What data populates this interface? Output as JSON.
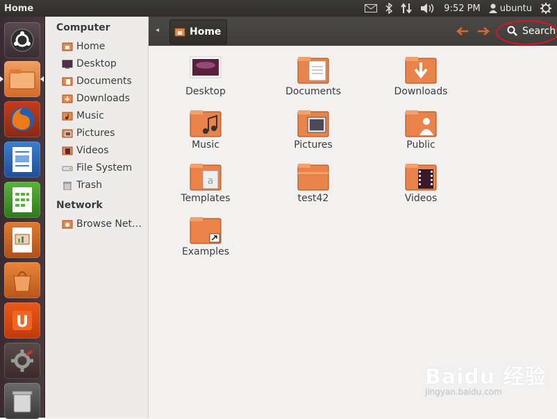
{
  "window": {
    "title": "Home"
  },
  "topbar": {
    "time": "9:52 PM",
    "user": "ubuntu"
  },
  "sidebar": {
    "sections": [
      {
        "heading": "Computer",
        "items": [
          {
            "label": "Home",
            "icon": "home-folder-icon"
          },
          {
            "label": "Desktop",
            "icon": "desktop-icon"
          },
          {
            "label": "Documents",
            "icon": "documents-folder-icon"
          },
          {
            "label": "Downloads",
            "icon": "downloads-folder-icon"
          },
          {
            "label": "Music",
            "icon": "music-folder-icon"
          },
          {
            "label": "Pictures",
            "icon": "pictures-folder-icon"
          },
          {
            "label": "Videos",
            "icon": "videos-folder-icon"
          },
          {
            "label": "File System",
            "icon": "drive-icon"
          },
          {
            "label": "Trash",
            "icon": "trash-icon"
          }
        ]
      },
      {
        "heading": "Network",
        "items": [
          {
            "label": "Browse Net…",
            "icon": "network-icon"
          }
        ]
      }
    ]
  },
  "toolbar": {
    "path_label": "Home",
    "search_label": "Search"
  },
  "files": [
    {
      "label": "Desktop",
      "icon": "desktop-icon"
    },
    {
      "label": "Documents",
      "icon": "documents-folder-icon"
    },
    {
      "label": "Downloads",
      "icon": "downloads-folder-icon"
    },
    {
      "label": "Music",
      "icon": "music-folder-icon"
    },
    {
      "label": "Pictures",
      "icon": "pictures-folder-icon"
    },
    {
      "label": "Public",
      "icon": "public-folder-icon"
    },
    {
      "label": "Templates",
      "icon": "templates-folder-icon"
    },
    {
      "label": "test42",
      "icon": "folder-icon"
    },
    {
      "label": "Videos",
      "icon": "videos-folder-icon"
    },
    {
      "label": "Examples",
      "icon": "examples-folder-icon"
    }
  ],
  "launcher": [
    {
      "name": "dash-home-icon"
    },
    {
      "name": "files-icon"
    },
    {
      "name": "firefox-icon"
    },
    {
      "name": "writer-icon"
    },
    {
      "name": "calc-icon"
    },
    {
      "name": "impress-icon"
    },
    {
      "name": "software-center-icon"
    },
    {
      "name": "ubuntu-one-icon"
    },
    {
      "name": "system-settings-icon"
    },
    {
      "name": "trash-icon"
    }
  ],
  "watermark": {
    "brand": "Baidu 经验",
    "url": "jingyan.baidu.com"
  },
  "colors": {
    "accent": "#dd4814",
    "panel": "#3c3b37",
    "highlight": "#e8101c"
  }
}
